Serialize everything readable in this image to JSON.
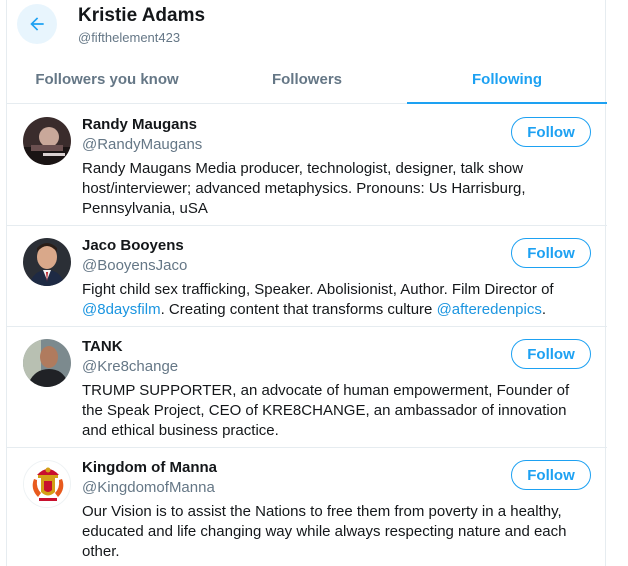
{
  "header": {
    "title": "Kristie Adams",
    "handle": "@fifthelement423"
  },
  "tabs": [
    {
      "label": "Followers you know",
      "active": false
    },
    {
      "label": "Followers",
      "active": false
    },
    {
      "label": "Following",
      "active": true
    }
  ],
  "users": [
    {
      "name": "Randy Maugans",
      "handle": "@RandyMaugans",
      "bio": "Randy Maugans Media producer, technologist, designer, talk show host/interviewer; advanced metaphysics. Pronouns: Us Harrisburg, Pennsylvania, uSA",
      "follow_label": "Follow"
    },
    {
      "name": "Jaco Booyens",
      "handle": "@BooyensJaco",
      "bio_part1": "Fight child sex trafficking, Speaker. Abolisionist, Author. Film Director of ",
      "bio_link1": "@8daysfilm",
      "bio_part2": ". Creating content that transforms culture ",
      "bio_link2": "@afteredenpics",
      "bio_part3": ".",
      "follow_label": "Follow"
    },
    {
      "name": "TANK",
      "handle": "@Kre8change",
      "bio": "TRUMP SUPPORTER, an advocate of human empowerment, Founder of the Speak Project, CEO of KRE8CHANGE, an ambassador of innovation and ethical business practice.",
      "follow_label": "Follow"
    },
    {
      "name": "Kingdom of Manna",
      "handle": "@KingdomofManna",
      "bio": "Our Vision is to assist the Nations to free them from poverty in a healthy, educated and life changing way while always respecting nature and each other.",
      "follow_label": "Follow"
    }
  ],
  "colors": {
    "accent": "#1da1f2",
    "link": "#1b95e0",
    "secondary_text": "#657786"
  }
}
